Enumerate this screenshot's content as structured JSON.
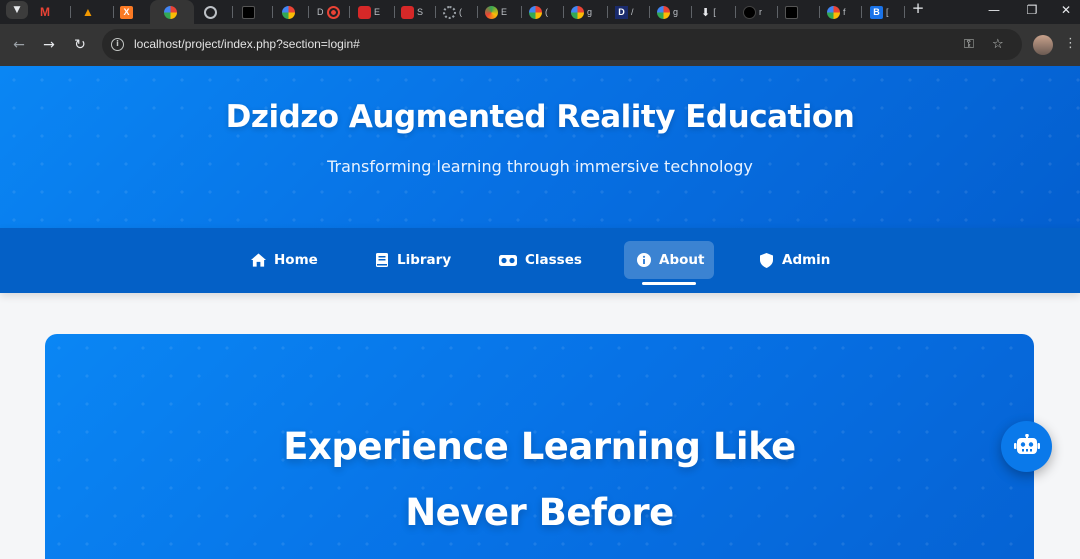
{
  "browser": {
    "tabs": [
      {
        "icon": "gmail-icon",
        "label": ""
      },
      {
        "icon": "warning-triangle-icon",
        "label": ""
      },
      {
        "icon": "xampp-icon",
        "label": ""
      },
      {
        "icon": "google-icon",
        "label": ""
      },
      {
        "icon": "globe-icon",
        "label": ""
      },
      {
        "icon": "dark-site-icon",
        "label": ""
      },
      {
        "icon": "google-icon",
        "label": ""
      },
      {
        "icon": "record-icon",
        "label": "D"
      },
      {
        "icon": "mcdonalds-icon",
        "label": "E"
      },
      {
        "icon": "mcdonalds-icon",
        "label": "S"
      },
      {
        "icon": "loading-icon",
        "label": "("
      },
      {
        "icon": "colorful-icon",
        "label": "E"
      },
      {
        "icon": "google-icon",
        "label": "("
      },
      {
        "icon": "google-icon",
        "label": "g"
      },
      {
        "icon": "d-logo-icon",
        "label": "/"
      },
      {
        "icon": "google-icon",
        "label": "g"
      },
      {
        "icon": "download-icon",
        "label": "["
      },
      {
        "icon": "github-icon",
        "label": "r"
      },
      {
        "icon": "dark-site-icon",
        "label": ""
      },
      {
        "icon": "google-icon",
        "label": "f"
      },
      {
        "icon": "b-logo-icon",
        "label": "["
      }
    ],
    "url": "localhost/project/index.php?section=login#"
  },
  "header": {
    "title": "Dzidzo Augmented Reality Education",
    "subtitle": "Transforming learning through immersive technology"
  },
  "nav": {
    "items": [
      {
        "label": "Home",
        "icon": "home-icon",
        "active": false
      },
      {
        "label": "Library",
        "icon": "book-icon",
        "active": false
      },
      {
        "label": "Classes",
        "icon": "vr-headset-icon",
        "active": false
      },
      {
        "label": "About",
        "icon": "info-icon",
        "active": true
      },
      {
        "label": "Admin",
        "icon": "shield-icon",
        "active": false
      }
    ]
  },
  "hero_card": {
    "heading_line1": "Experience Learning Like",
    "heading_line2": "Never Before"
  },
  "chatbot": {
    "icon": "robot-icon"
  },
  "colors": {
    "primary": "#0770e3",
    "nav": "#0460c6",
    "accent": "#0a86f4"
  }
}
